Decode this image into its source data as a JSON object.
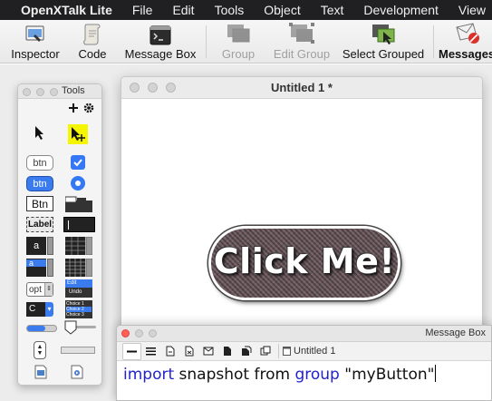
{
  "menubar": {
    "app_name": "OpenXTalk Lite",
    "menus": [
      "File",
      "Edit",
      "Tools",
      "Object",
      "Text",
      "Development",
      "View"
    ]
  },
  "toolbar": {
    "inspector": "Inspector",
    "code": "Code",
    "message_box": "Message Box",
    "group": "Group",
    "edit_group": "Edit Group",
    "select_grouped": "Select Grouped",
    "messages": "Messages"
  },
  "palette": {
    "title": "Tools",
    "btn_label": "btn",
    "btn_blue_label": "btn",
    "btn_default_label": "Btn",
    "label_field": "Label",
    "field_a1": "a",
    "field_a2": "a",
    "option_label": "opt",
    "combo_label": "C",
    "menu_edit": "Edit",
    "menu_undo": "Undo",
    "choice_1": "Choice 1",
    "choice_2": "Choice 2",
    "choice_3": "Choice 3"
  },
  "stack_window": {
    "title": "Untitled 1 *",
    "button_label": "Click Me!"
  },
  "message_box": {
    "title": "Message Box",
    "tab_label": "Untitled 1",
    "cmd_import": "import",
    "cmd_mid": "snapshot from",
    "cmd_group": "group",
    "cmd_arg": "\"myButton\""
  },
  "colors": {
    "menubar_bg": "#202022",
    "keyword": "#2222cc",
    "palette_selected": "#f5f500",
    "close_red": "#ff5f57"
  }
}
